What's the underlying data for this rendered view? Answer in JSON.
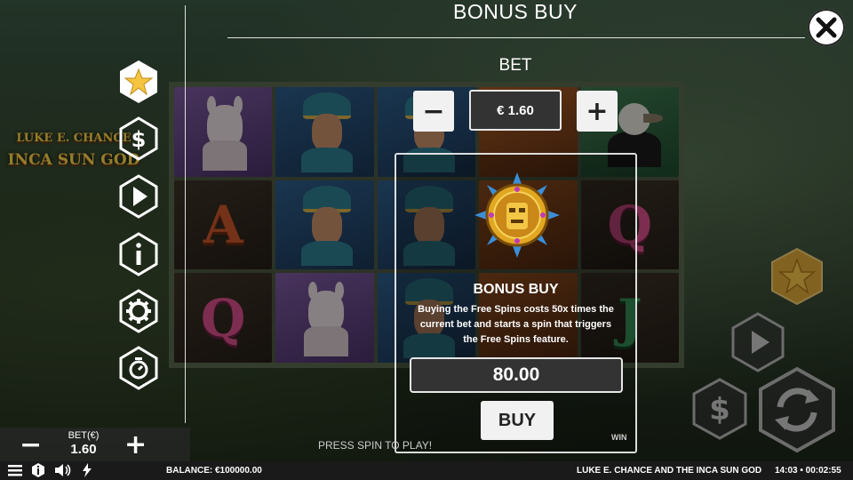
{
  "header": {
    "title": "BONUS BUY"
  },
  "bet": {
    "label": "BET",
    "value": "€ 1.60",
    "minus": "−",
    "plus": "+"
  },
  "bonus_panel": {
    "title": "BONUS BUY",
    "description": "Buying the Free Spins costs 50x times the current bet and starts a spin that triggers the Free Spins feature.",
    "price": "80.00",
    "buy_label": "BUY"
  },
  "logo": {
    "line1": "LUKE E. CHANCE",
    "line2": "INCA SUN GOD"
  },
  "reels": {
    "letters": {
      "A": "A",
      "Q": "Q",
      "J": "J"
    }
  },
  "bet_strip": {
    "minus": "−",
    "label": "BET(€)",
    "value": "1.60",
    "plus": "+"
  },
  "press_spin": "PRESS SPIN TO PLAY!",
  "win_label": "WIN",
  "status_bar": {
    "balance": "BALANCE: €100000.00",
    "game_title": "LUKE E. CHANCE AND THE INCA SUN GOD",
    "time": "14:03 • 00:02:55"
  },
  "colors": {
    "accent_gold": "#f5c542",
    "panel_border": "#e6e6e6",
    "button_bg": "#f1f1f1"
  }
}
